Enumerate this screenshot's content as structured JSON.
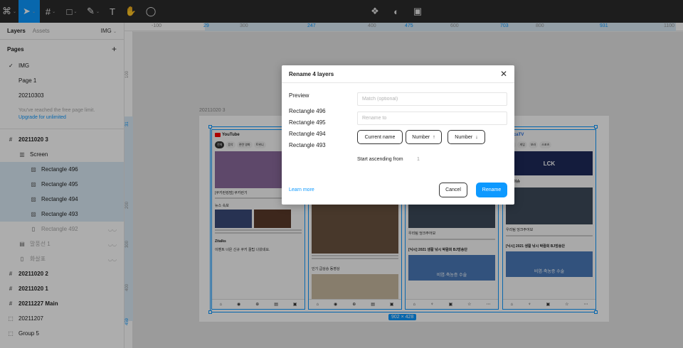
{
  "toolbar": {
    "items": [
      {
        "name": "main-menu-icon",
        "glyph": "⌘"
      },
      {
        "name": "move-tool-icon",
        "glyph": "➤"
      },
      {
        "name": "frame-tool-icon",
        "glyph": "#"
      },
      {
        "name": "rectangle-tool-icon",
        "glyph": "□"
      },
      {
        "name": "pen-tool-icon",
        "glyph": "✎"
      },
      {
        "name": "text-tool-icon",
        "glyph": "T"
      },
      {
        "name": "hand-tool-icon",
        "glyph": "✋"
      },
      {
        "name": "comment-tool-icon",
        "glyph": "◯"
      }
    ],
    "right": [
      {
        "name": "component-icon",
        "glyph": "❖"
      },
      {
        "name": "mask-icon",
        "glyph": "◐"
      },
      {
        "name": "boolean-icon",
        "glyph": "▣"
      }
    ],
    "accent": "#0d99ff"
  },
  "left_panel": {
    "tab_layers": "Layers",
    "tab_assets": "Assets",
    "page_selector": "IMG",
    "pages_title": "Pages",
    "pages": [
      "IMG",
      "Page 1",
      "20210303"
    ],
    "free_limit": "You've reached the free page limit.",
    "upgrade": "Upgrade for unlimited",
    "layers": [
      {
        "label": "20211020 3",
        "icon": "#",
        "indent": 0,
        "bold": true,
        "selected": false,
        "dim": false
      },
      {
        "label": "Screen",
        "icon": "▥",
        "indent": 1,
        "bold": false,
        "selected": false,
        "dim": false
      },
      {
        "label": "Rectangle 496",
        "icon": "▨",
        "indent": 2,
        "bold": false,
        "selected": true,
        "dim": false
      },
      {
        "label": "Rectangle 495",
        "icon": "▨",
        "indent": 2,
        "bold": false,
        "selected": true,
        "dim": false
      },
      {
        "label": "Rectangle 494",
        "icon": "▨",
        "indent": 2,
        "bold": false,
        "selected": true,
        "dim": false
      },
      {
        "label": "Rectangle 493",
        "icon": "▨",
        "indent": 2,
        "bold": false,
        "selected": true,
        "dim": false
      },
      {
        "label": "Rectangle 492",
        "icon": "▯",
        "indent": 2,
        "bold": false,
        "selected": false,
        "dim": true,
        "hidden": true
      },
      {
        "label": "말풍선 1",
        "icon": "▤",
        "indent": 1,
        "bold": false,
        "selected": false,
        "dim": true,
        "hidden": true
      },
      {
        "label": "화살표",
        "icon": "▯",
        "indent": 1,
        "bold": false,
        "selected": false,
        "dim": true,
        "hidden": true
      },
      {
        "label": "20211020 2",
        "icon": "#",
        "indent": 0,
        "bold": true,
        "selected": false,
        "dim": false
      },
      {
        "label": "20211020 1",
        "icon": "#",
        "indent": 0,
        "bold": true,
        "selected": false,
        "dim": false
      },
      {
        "label": "20211227 Main",
        "icon": "#",
        "indent": 0,
        "bold": true,
        "selected": false,
        "dim": false
      },
      {
        "label": "20211207",
        "icon": "⬚",
        "indent": 0,
        "bold": false,
        "selected": false,
        "dim": false
      },
      {
        "label": "Group 5",
        "icon": "⬚",
        "indent": 0,
        "bold": false,
        "selected": false,
        "dim": false
      }
    ]
  },
  "rulers": {
    "h_labels": [
      {
        "t": "-100",
        "b": false
      },
      {
        "t": "29",
        "b": true
      },
      {
        "t": "300",
        "b": false
      },
      {
        "t": "247",
        "b": true
      },
      {
        "t": "400",
        "b": false
      },
      {
        "t": "475",
        "b": true
      },
      {
        "t": "600",
        "b": false
      },
      {
        "t": "703",
        "b": true
      },
      {
        "t": "800",
        "b": false
      },
      {
        "t": "931",
        "b": true
      },
      {
        "t": "1100",
        "b": false
      }
    ],
    "v_labels": [
      {
        "t": "100",
        "b": false
      },
      {
        "t": "31",
        "b": true
      },
      {
        "t": "200",
        "b": false
      },
      {
        "t": "300",
        "b": false
      },
      {
        "t": "400",
        "b": false
      },
      {
        "t": "459",
        "b": true
      }
    ]
  },
  "canvas": {
    "frame_label": "20211020 3",
    "dimensions": "902 × 428",
    "screens": [
      {
        "header": "YouTube",
        "type": "yt1"
      },
      {
        "header": "",
        "type": "yt2"
      },
      {
        "header": "",
        "type": "af1"
      },
      {
        "header": "freecaTV",
        "type": "af2"
      }
    ],
    "yt_chips": [
      "전체",
      "음악",
      "관련 영화",
      "트위니"
    ],
    "snippets": {
      "s1_title": "[쿠키런킹덤] 쿠키런기",
      "s1_news": "뉴스 속보",
      "s1_chan": "Zitalks",
      "s1_text": "이벤트 너은 신규 쿠키 꿀팁 나왔네요.",
      "s2_hot": "인기 급상승 동영상",
      "s3_title": "우리팀 엉크주어보",
      "s3_bottom": "[닉시] 2021 생활 낚시 박람회 BJ방송단",
      "s3_banner": "비염·축농증 수술",
      "s4_lck": "LCK",
      "s4_live": "먼 핫이슈"
    }
  },
  "dialog": {
    "title": "Rename 4 layers",
    "preview_title": "Preview",
    "preview_items": [
      "Rectangle 496",
      "Rectangle 495",
      "Rectangle 494",
      "Rectangle 493"
    ],
    "match_placeholder": "Match (optional)",
    "rename_placeholder": "Rename to",
    "btn_current": "Current name",
    "btn_number_up": "Number",
    "btn_number_down": "Number",
    "up_arrow": "↑",
    "down_arrow": "↓",
    "start_label": "Start ascending from",
    "start_value": "1",
    "learn_more": "Learn more",
    "cancel": "Cancel",
    "rename": "Rename"
  }
}
